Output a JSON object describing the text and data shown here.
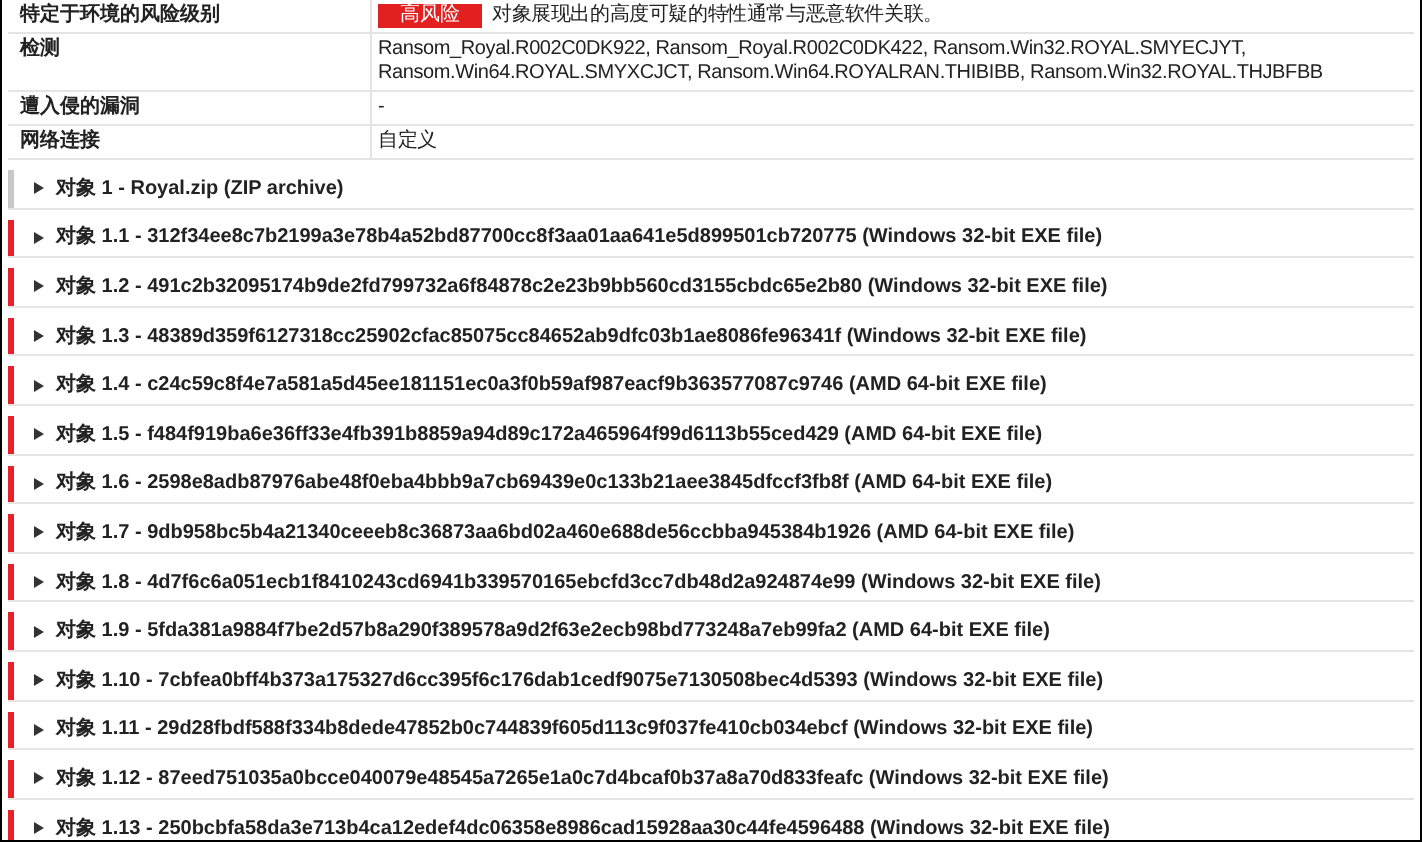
{
  "properties": [
    {
      "label": "特定于环境的风险级别",
      "badge": "高风险",
      "value": "对象展现出的高度可疑的特性通常与恶意软件关联。"
    },
    {
      "label": "检测",
      "value": "Ransom_Royal.R002C0DK922, Ransom_Royal.R002C0DK422, Ransom.Win32.ROYAL.SMYECJYT, Ransom.Win64.ROYAL.SMYXCJCT, Ransom.Win64.ROYALRAN.THIBIBB, Ransom.Win32.ROYAL.THJBFBB"
    },
    {
      "label": "遭入侵的漏洞",
      "value": "-"
    },
    {
      "label": "网络连接",
      "value": "自定义"
    }
  ],
  "objects": [
    {
      "title": "对象 1 - Royal.zip (ZIP archive)",
      "expanded": false,
      "color": "#c8c8c8"
    },
    {
      "title": "对象 1.1 - 312f34ee8c7b2199a3e78b4a52bd87700cc8f3aa01aa641e5d899501cb720775 (Windows 32-bit EXE file)",
      "expanded": false,
      "color": "#e8202a"
    },
    {
      "title": "对象 1.2 - 491c2b32095174b9de2fd799732a6f84878c2e23b9bb560cd3155cbdc65e2b80 (Windows 32-bit EXE file)",
      "expanded": false,
      "color": "#e8202a"
    },
    {
      "title": "对象 1.3 - 48389d359f6127318cc25902cfac85075cc84652ab9dfc03b1ae8086fe96341f (Windows 32-bit EXE file)",
      "expanded": false,
      "color": "#e8202a"
    },
    {
      "title": "对象 1.4 - c24c59c8f4e7a581a5d45ee181151ec0a3f0b59af987eacf9b363577087c9746 (AMD 64-bit EXE file)",
      "expanded": false,
      "color": "#e8202a"
    },
    {
      "title": "对象 1.5 - f484f919ba6e36ff33e4fb391b8859a94d89c172a465964f99d6113b55ced429 (AMD 64-bit EXE file)",
      "expanded": false,
      "color": "#e8202a"
    },
    {
      "title": "对象 1.6 - 2598e8adb87976abe48f0eba4bbb9a7cb69439e0c133b21aee3845dfccf3fb8f (AMD 64-bit EXE file)",
      "expanded": false,
      "color": "#e8202a"
    },
    {
      "title": "对象 1.7 - 9db958bc5b4a21340ceeeb8c36873aa6bd02a460e688de56ccbba945384b1926 (AMD 64-bit EXE file)",
      "expanded": false,
      "color": "#e8202a"
    },
    {
      "title": "对象 1.8 - 4d7f6c6a051ecb1f8410243cd6941b339570165ebcfd3cc7db48d2a924874e99 (Windows 32-bit EXE file)",
      "expanded": false,
      "color": "#e8202a"
    },
    {
      "title": "对象 1.9 - 5fda381a9884f7be2d57b8a290f389578a9d2f63e2ecb98bd773248a7eb99fa2 (AMD 64-bit EXE file)",
      "expanded": false,
      "color": "#e8202a"
    },
    {
      "title": "对象 1.10 - 7cbfea0bff4b373a175327d6cc395f6c176dab1cedf9075e7130508bec4d5393 (Windows 32-bit EXE file)",
      "expanded": false,
      "color": "#e8202a"
    },
    {
      "title": "对象 1.11 - 29d28fbdf588f334b8dede47852b0c744839f605d113c9f037fe410cb034ebcf (Windows 32-bit EXE file)",
      "expanded": false,
      "color": "#e8202a"
    },
    {
      "title": "对象 1.12 - 87eed751035a0bcce040079e48545a7265e1a0c7d4bcaf0b37a8a70d833feafc (Windows 32-bit EXE file)",
      "expanded": false,
      "color": "#e8202a"
    },
    {
      "title": "对象 1.13 - 250bcbfa58da3e713b4ca12edef4dc06358e8986cad15928aa30c44fe4596488 (Windows 32-bit EXE file)",
      "expanded": false,
      "color": "#e8202a"
    }
  ]
}
